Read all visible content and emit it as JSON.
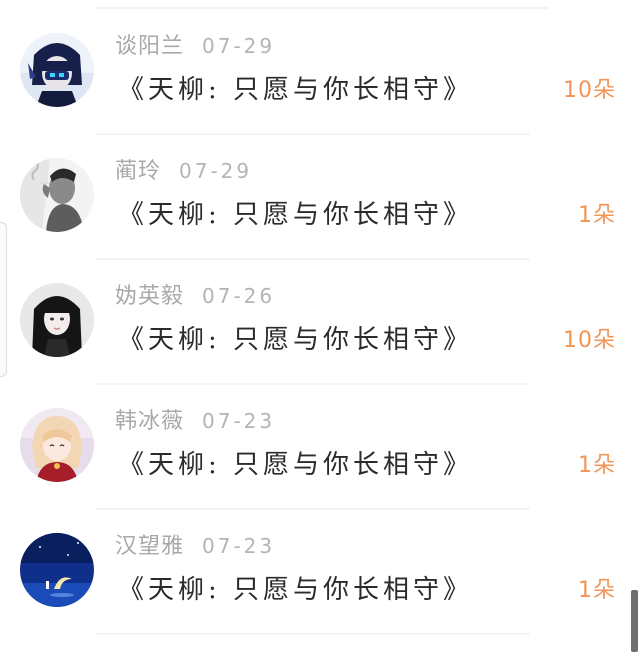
{
  "colors": {
    "name_text": "#a9a9a9",
    "title_text": "#2b2b2b",
    "count_text": "#f29555",
    "divider": "#f4f4f4"
  },
  "gift_list": [
    {
      "avatar_icon": "avatar-anime-boy-blue-hair",
      "name": "谈阳兰",
      "date": "07-29",
      "gift_title": "《天柳: 只愿与你长相守》",
      "count": "10朵"
    },
    {
      "avatar_icon": "avatar-man-smoking",
      "name": "蔺玲",
      "date": "07-29",
      "gift_title": "《天柳: 只愿与你长相守》",
      "count": "1朵"
    },
    {
      "avatar_icon": "avatar-girl-long-black-hair",
      "name": "妫英毅",
      "date": "07-26",
      "gift_title": "《天柳: 只愿与你长相守》",
      "count": "10朵"
    },
    {
      "avatar_icon": "avatar-anime-girl-purple",
      "name": "韩冰薇",
      "date": "07-23",
      "gift_title": "《天柳: 只愿与你长相守》",
      "count": "1朵"
    },
    {
      "avatar_icon": "avatar-crescent-moon-night",
      "name": "汉望雅",
      "date": "07-23",
      "gift_title": "《天柳: 只愿与你长相守》",
      "count": "1朵"
    }
  ]
}
